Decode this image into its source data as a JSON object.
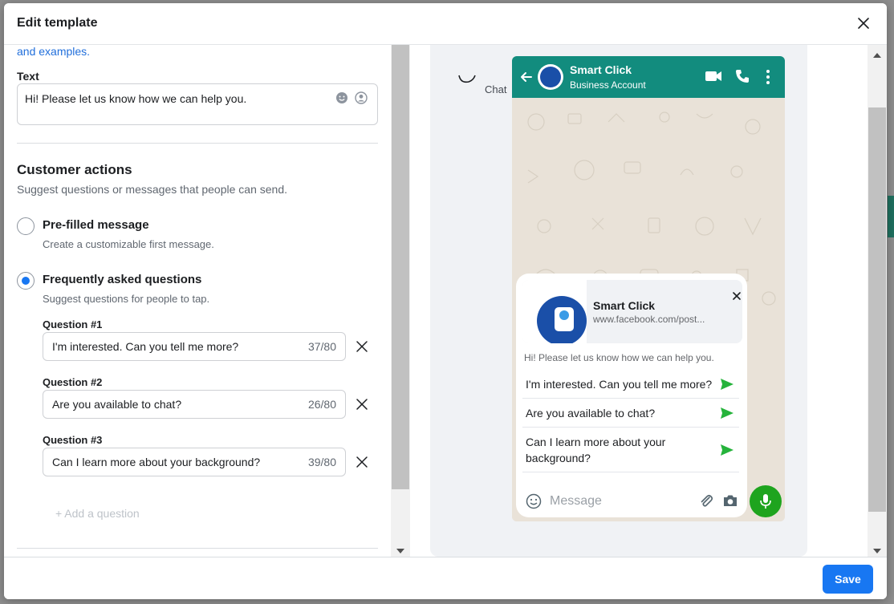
{
  "modal": {
    "title": "Edit template",
    "save_label": "Save"
  },
  "left": {
    "link_text": "and examples.",
    "text_label": "Text",
    "text_value": "Hi! Please let us know how we can help you.",
    "customer_actions": {
      "title": "Customer actions",
      "subtitle": "Suggest questions or messages that people can send."
    },
    "options": [
      {
        "title": "Pre-filled message",
        "subtitle": "Create a customizable first message.",
        "selected": false
      },
      {
        "title": "Frequently asked questions",
        "subtitle": "Suggest questions for people to tap.",
        "selected": true
      }
    ],
    "questions": [
      {
        "label": "Question #1",
        "value": "I'm interested. Can you tell me more?",
        "count": "37/80"
      },
      {
        "label": "Question #2",
        "value": "Are you available to chat?",
        "count": "26/80"
      },
      {
        "label": "Question #3",
        "value": "Can I learn more about your background?",
        "count": "39/80"
      }
    ],
    "add_question": "+ Add a question"
  },
  "preview": {
    "chat_label": "Chat",
    "header": {
      "name": "Smart Click",
      "status": "Business Account"
    },
    "link_preview": {
      "title": "Smart Click",
      "url": "www.facebook.com/post..."
    },
    "message": "Hi! Please let us know how we can help you.",
    "faqs": [
      "I'm interested. Can you tell me more?",
      "Are you available to chat?",
      "Can I learn more about your background?"
    ],
    "input_placeholder": "Message"
  },
  "colors": {
    "accent": "#1877f2",
    "whatsapp_header": "#128c7e",
    "send_green": "#25b33b",
    "mic_green": "#1ea41e"
  }
}
